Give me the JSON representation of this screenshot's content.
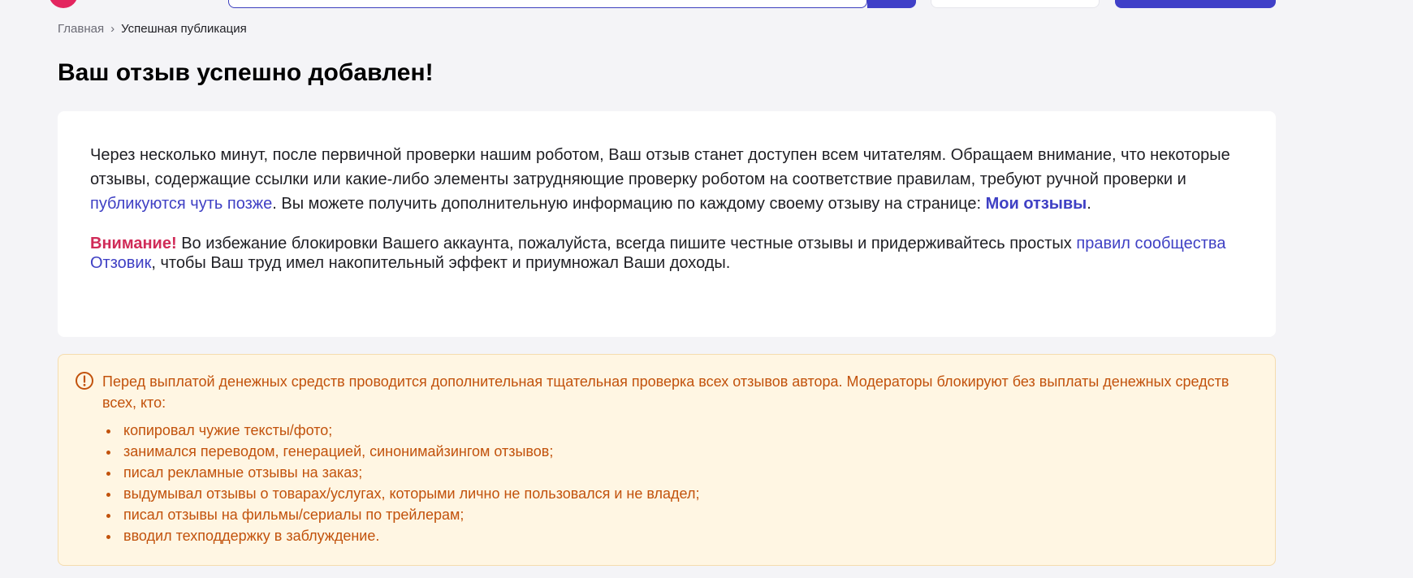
{
  "breadcrumb": {
    "home": "Главная",
    "separator": "›",
    "current": "Успешная публикация"
  },
  "page": {
    "title": "Ваш отзыв успешно добавлен!"
  },
  "card": {
    "p1_part1": "Через несколько минут, после первичной проверки нашим роботом, Ваш отзыв станет доступен всем читателям. Обращаем внимание, что некоторые отзывы, содержащие ссылки или какие-либо элементы затрудняющие проверку роботом на соответствие правилам, требуют ручной проверки и ",
    "p1_link": "публикуются чуть позже",
    "p1_part2": ". Вы можете получить дополнительную информацию по каждому своему отзыву на странице: ",
    "my_reviews_link": "Мои отзывы",
    "p1_end": ".",
    "warning_label": "Внимание!",
    "p2_part1": " Во избежание блокировки Вашего аккаунта, пожалуйста, всегда пишите честные отзывы и придерживайтесь простых ",
    "p2_link": "правил сообщества Отзовик",
    "p2_part2": ", чтобы Ваш труд имел накопительный эффект и приумножал Ваши доходы."
  },
  "notice": {
    "icon": "exclamation-circle-icon",
    "text": "Перед выплатой денежных средств проводится дополнительная тщательная проверка всех отзывов автора. Модераторы блокируют без выплаты денежных средств всех, кто:",
    "items": [
      "копировал чужие тексты/фото;",
      "занимался переводом, генерацией, синонимайзингом отзывов;",
      "писал рекламные отзывы на заказ;",
      "выдумывал отзывы о товарах/услугах, которыми лично не пользовался и не владел;",
      "писал отзывы на фильмы/сериалы по трейлерам;",
      "вводил техподдержку в заблуждение."
    ]
  },
  "colors": {
    "accent": "#3f40c4",
    "brand": "#e3255f",
    "warning_text": "#c2520c",
    "warning_bg": "#fff6e3"
  }
}
